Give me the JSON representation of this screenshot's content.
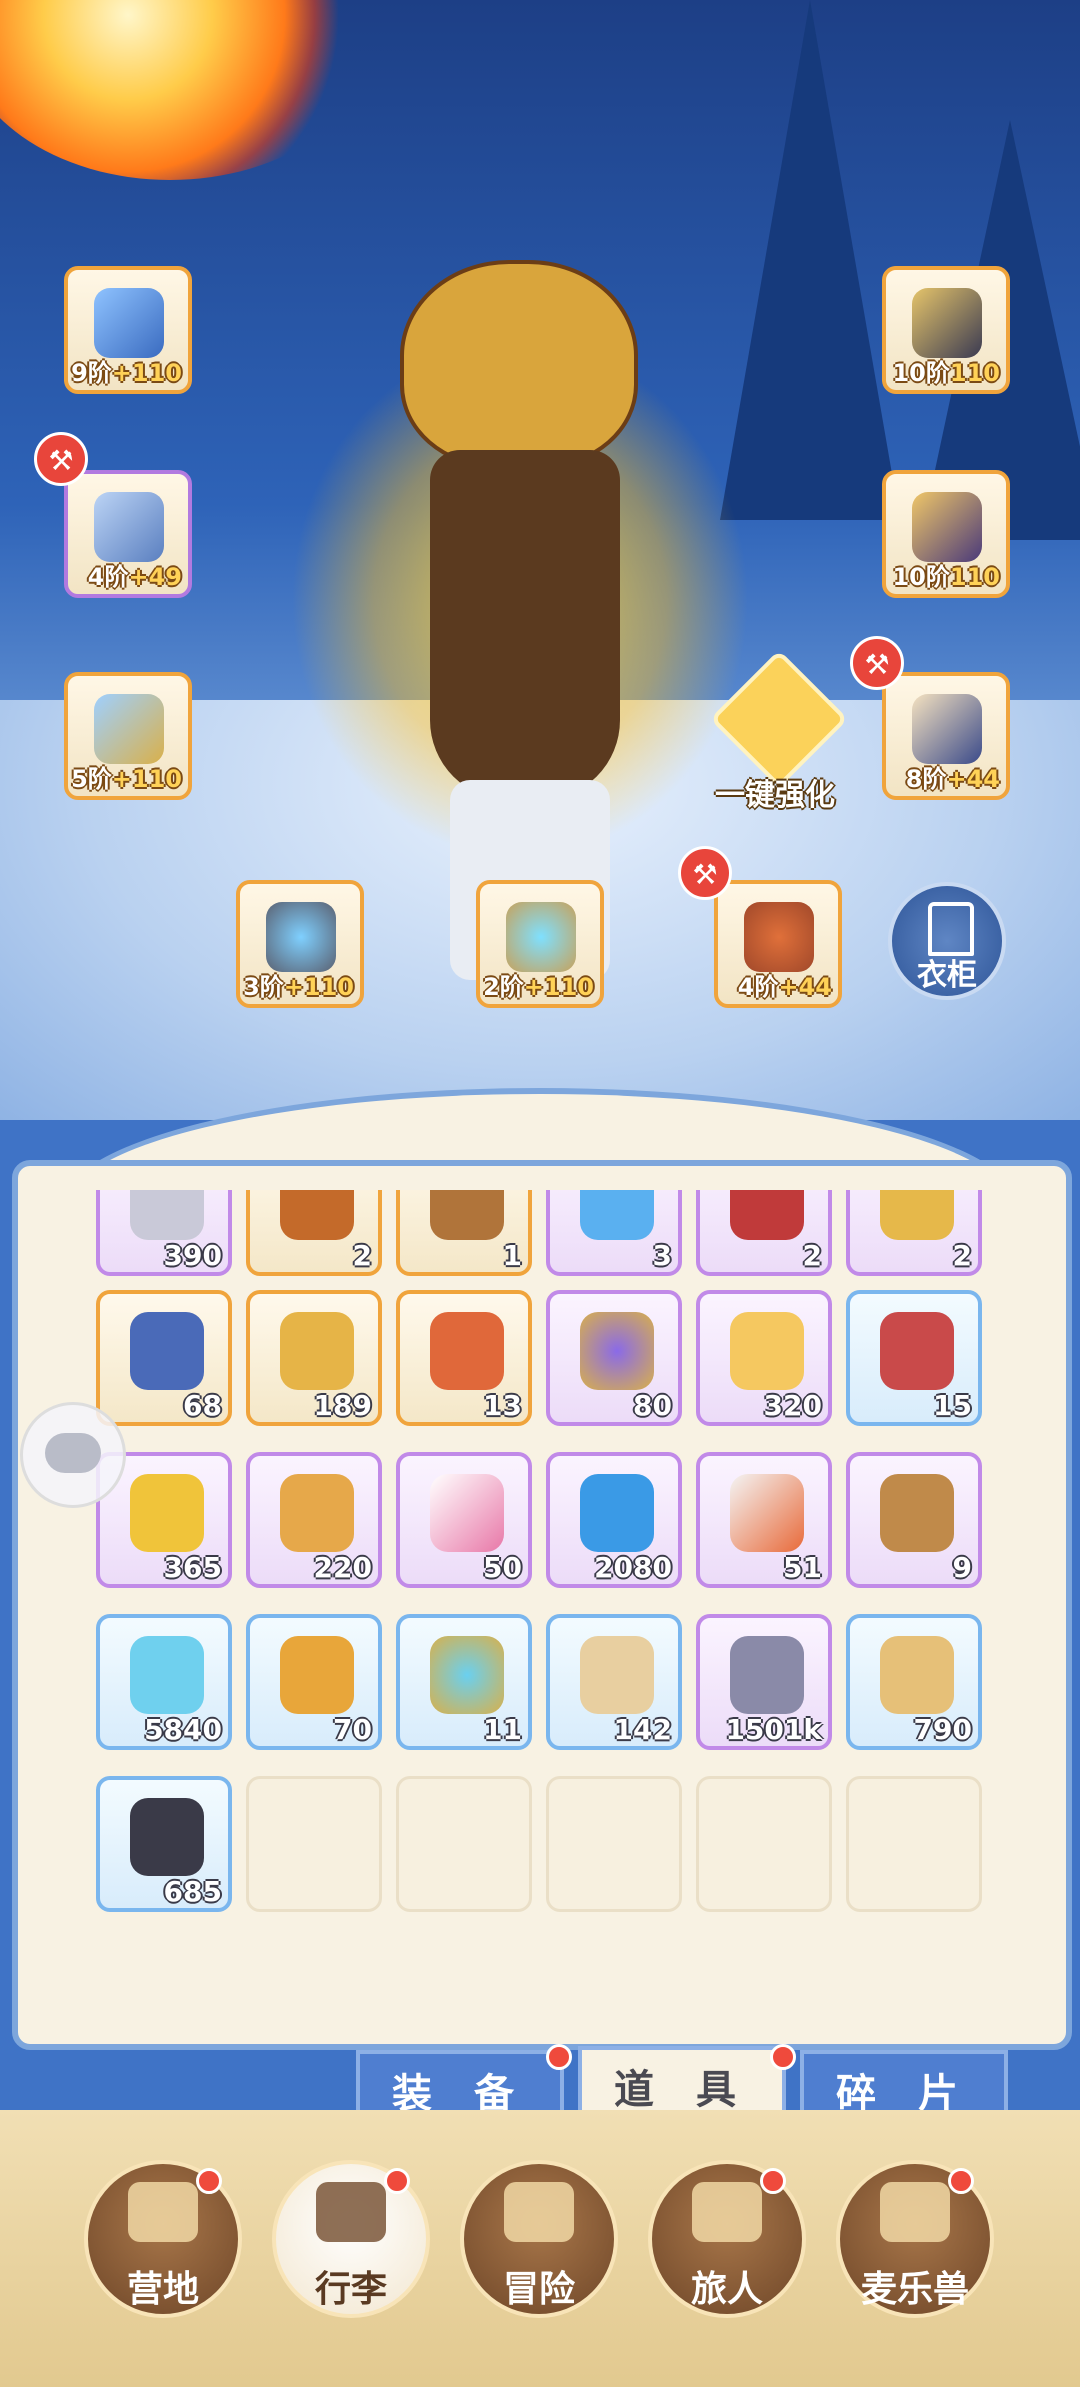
{
  "equipment": {
    "weapon": {
      "icon": "halberd-icon",
      "tier": "9阶",
      "bonus": "+110"
    },
    "armor": {
      "icon": "chest-armor-icon",
      "tier": "4阶",
      "bonus": "+49"
    },
    "pants": {
      "icon": "leg-armor-icon",
      "tier": "5阶",
      "bonus": "+110"
    },
    "helmet": {
      "icon": "helmet-icon",
      "tier": "10阶",
      "bonus": "110"
    },
    "gauntlet": {
      "icon": "gauntlet-icon",
      "tier": "10阶",
      "bonus": "110"
    },
    "boots": {
      "icon": "boots-icon",
      "tier": "8阶",
      "bonus": "+44"
    },
    "ring": {
      "icon": "ring-icon",
      "tier": "3阶",
      "bonus": "+110"
    },
    "necklace": {
      "icon": "necklace-icon",
      "tier": "2阶",
      "bonus": "+110"
    },
    "charm": {
      "icon": "charm-icon",
      "tier": "4阶",
      "bonus": "+44"
    }
  },
  "one_key_enhance": "一键强化",
  "wardrobe": "衣柜",
  "inventory": {
    "row0": [
      {
        "icon": "coin-icon",
        "qty": "390",
        "rarity": "purple"
      },
      {
        "icon": "sword-icon",
        "qty": "2",
        "rarity": "orange"
      },
      {
        "icon": "boot-item-icon",
        "qty": "1",
        "rarity": "orange"
      },
      {
        "icon": "potion-icon",
        "qty": "3",
        "rarity": "purple"
      },
      {
        "icon": "gem-red-icon",
        "qty": "2",
        "rarity": "purple"
      },
      {
        "icon": "key-icon",
        "qty": "2",
        "rarity": "purple"
      }
    ],
    "row1": [
      {
        "icon": "blue-card-icon",
        "qty": "68",
        "rarity": "orange"
      },
      {
        "icon": "gold-card-icon",
        "qty": "189",
        "rarity": "orange"
      },
      {
        "icon": "red-card-icon",
        "qty": "13",
        "rarity": "orange"
      },
      {
        "icon": "cat-mirror-icon",
        "qty": "80",
        "rarity": "purple"
      },
      {
        "icon": "cheese-icon",
        "qty": "320",
        "rarity": "purple"
      },
      {
        "icon": "meat-icon",
        "qty": "15",
        "rarity": "blue"
      }
    ],
    "row2": [
      {
        "icon": "leaf-icon",
        "qty": "365",
        "rarity": "purple"
      },
      {
        "icon": "star-cookie-icon",
        "qty": "220",
        "rarity": "purple"
      },
      {
        "icon": "tube-icon",
        "qty": "50",
        "rarity": "purple"
      },
      {
        "icon": "blue-jelly-icon",
        "qty": "2080",
        "rarity": "purple"
      },
      {
        "icon": "ticket-icon",
        "qty": "51",
        "rarity": "purple"
      },
      {
        "icon": "book-icon",
        "qty": "9",
        "rarity": "purple"
      }
    ],
    "row3": [
      {
        "icon": "crystal-icon",
        "qty": "5840",
        "rarity": "blue"
      },
      {
        "icon": "amber-icon",
        "qty": "70",
        "rarity": "blue"
      },
      {
        "icon": "cat-mirror-blue-icon",
        "qty": "11",
        "rarity": "blue"
      },
      {
        "icon": "paw-bag-icon",
        "qty": "142",
        "rarity": "blue"
      },
      {
        "icon": "iron-ingot-icon",
        "qty": "1501k",
        "rarity": "purple"
      },
      {
        "icon": "scroll-card-icon",
        "qty": "790",
        "rarity": "blue"
      }
    ],
    "row4": [
      {
        "icon": "ore-icon",
        "qty": "685",
        "rarity": "blue"
      }
    ]
  },
  "tabs": {
    "equipment": "装 备",
    "items": "道 具",
    "fragments": "碎 片"
  },
  "nav": {
    "camp": "营地",
    "luggage": "行李",
    "adventure": "冒险",
    "traveler": "旅人",
    "pet": "麦乐兽"
  },
  "colors": {
    "orange_frame": "#f0a43c",
    "purple_frame": "#b27ae0",
    "blue_frame": "#7ab6ee",
    "badge_red": "#ef4a3c"
  }
}
